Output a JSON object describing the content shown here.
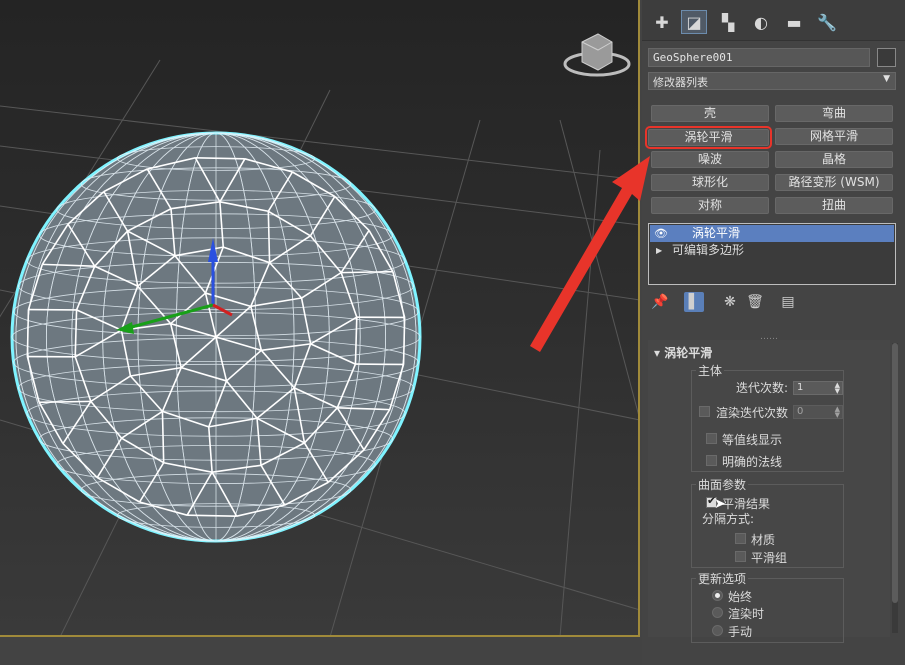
{
  "panel": {
    "tabs": [
      {
        "icon": "plus-icon"
      },
      {
        "icon": "modify-icon"
      },
      {
        "icon": "hierarchy-icon"
      },
      {
        "icon": "motion-icon"
      },
      {
        "icon": "display-icon"
      },
      {
        "icon": "utilities-icon"
      }
    ],
    "object_name": "GeoSphere001",
    "modifier_list": "修改器列表",
    "modifier_buttons": [
      {
        "label": "壳",
        "highlight": false
      },
      {
        "label": "弯曲",
        "highlight": false
      },
      {
        "label": "涡轮平滑",
        "highlight": true
      },
      {
        "label": "网格平滑",
        "highlight": false
      },
      {
        "label": "噪波",
        "highlight": false
      },
      {
        "label": "晶格",
        "highlight": false
      },
      {
        "label": "球形化",
        "highlight": false
      },
      {
        "label": "路径变形 (WSM)",
        "highlight": false
      },
      {
        "label": "对称",
        "highlight": false
      },
      {
        "label": "扭曲",
        "highlight": false
      }
    ],
    "stack": [
      {
        "label": "涡轮平滑",
        "selected": true
      },
      {
        "label": "可编辑多边形",
        "selected": false
      }
    ]
  },
  "rollout": {
    "title": "涡轮平滑",
    "main_group": "主体",
    "iterations_label": "迭代次数:",
    "iterations_value": "1",
    "render_iters_label": "渲染迭代次数",
    "render_iters_value": "0",
    "isoline_label": "等值线显示",
    "explicit_normals_label": "明确的法线",
    "surface_group": "曲面参数",
    "smooth_result_label": "平滑结果",
    "separate_label": "分隔方式:",
    "materials_label": "材质",
    "smoothing_groups_label": "平滑组",
    "update_group": "更新选项",
    "update_always": "始终",
    "update_render": "渲染时",
    "update_manual": "手动"
  },
  "colors": {
    "selection_blue": "#5b7fbf",
    "highlight_red": "#e8342a",
    "wire_cyan": "#7ff3ff"
  }
}
